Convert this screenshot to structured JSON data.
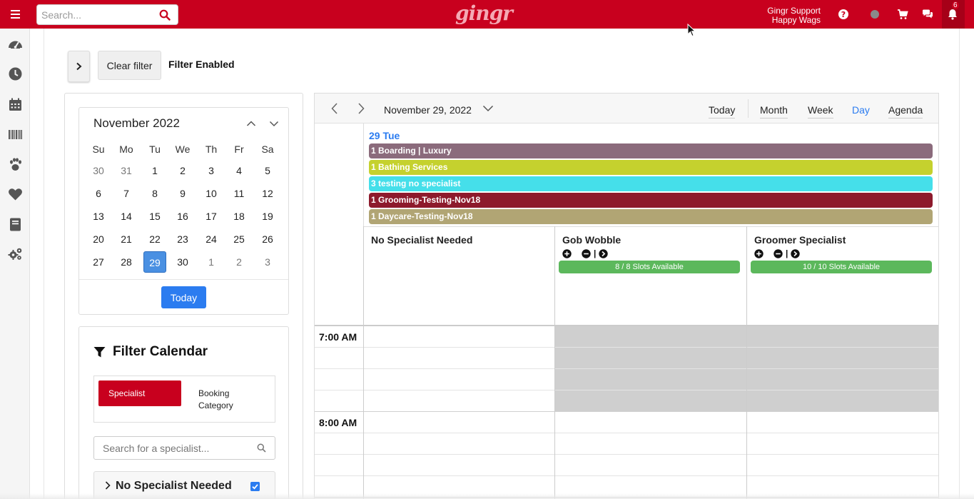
{
  "topbar": {
    "search_placeholder": "Search...",
    "logo_text": "gingr",
    "user_name": "Gingr Support",
    "location_name": "Happy Wags",
    "notification_count": "6",
    "brand_color": "#c8001e"
  },
  "left_nav": {
    "items": [
      "dashboard-icon",
      "clock-icon",
      "calendar-icon",
      "barcode-icon",
      "paw-icon",
      "heart-icon",
      "book-icon",
      "gears-icon"
    ]
  },
  "filter_bar": {
    "clear_label": "Clear filter",
    "status_label": "Filter Enabled"
  },
  "mini_calendar": {
    "month_title": "November 2022",
    "weekdays": [
      "Su",
      "Mo",
      "Tu",
      "We",
      "Th",
      "Fr",
      "Sa"
    ],
    "weeks": [
      [
        "30",
        "31",
        "1",
        "2",
        "3",
        "4",
        "5"
      ],
      [
        "6",
        "7",
        "8",
        "9",
        "10",
        "11",
        "12"
      ],
      [
        "13",
        "14",
        "15",
        "16",
        "17",
        "18",
        "19"
      ],
      [
        "20",
        "21",
        "22",
        "23",
        "24",
        "25",
        "26"
      ],
      [
        "27",
        "28",
        "29",
        "30",
        "1",
        "2",
        "3"
      ]
    ],
    "selected_day": "29",
    "today_label": "Today"
  },
  "filter_calendar": {
    "title": "Filter Calendar",
    "tab_specialist": "Specialist",
    "tab_booking_line1": "Booking",
    "tab_booking_line2": "Category",
    "search_placeholder": "Search for a specialist...",
    "group_label": "No Specialist Needed",
    "group_checked": true
  },
  "calendar": {
    "date_label": "November 29, 2022",
    "views": [
      "Today",
      "Month",
      "Week",
      "Day",
      "Agenda"
    ],
    "active_view": "Day",
    "day_header": "29 Tue",
    "all_day_events": [
      {
        "label": "1 Boarding | Luxury",
        "color": "#8b6b7c"
      },
      {
        "label": "1 Bathing Services",
        "color": "#c5d12e"
      },
      {
        "label": "3 testing no specialist",
        "color": "#45dfea"
      },
      {
        "label": "1 Grooming-Testing-Nov18",
        "color": "#8d1a2c"
      },
      {
        "label": "1 Daycare-Testing-Nov18",
        "color": "#b1a574"
      }
    ],
    "resources": [
      {
        "title": "No Specialist Needed",
        "slots": ""
      },
      {
        "title": "Gob Wobble",
        "slots": "8 / 8 Slots Available"
      },
      {
        "title": "Groomer Specialist",
        "slots": "10 / 10 Slots Available"
      }
    ],
    "resource_separator": "|",
    "times": [
      "7:00 AM",
      "8:00 AM"
    ],
    "slot_color": "#5cb85c",
    "blocked_color": "#cfcfcf"
  }
}
